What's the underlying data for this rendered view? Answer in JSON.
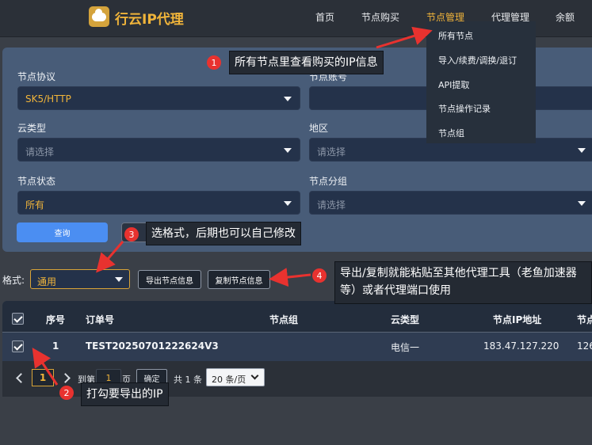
{
  "header": {
    "brand": "行云IP代理",
    "nav": [
      "首页",
      "节点购买",
      "节点管理",
      "代理管理",
      "余额"
    ]
  },
  "dropdown": [
    "所有节点",
    "导入/续费/调换/退订",
    "API提取",
    "节点操作记录",
    "节点组"
  ],
  "filters": {
    "protocol": {
      "label": "节点协议",
      "value": "SK5/HTTP"
    },
    "account": {
      "label": "节点账号",
      "value": ""
    },
    "cloud_type": {
      "label": "云类型",
      "placeholder": "请选择"
    },
    "region": {
      "label": "地区",
      "placeholder": "请选择"
    },
    "status": {
      "label": "节点状态",
      "value": "所有"
    },
    "group": {
      "label": "节点分组",
      "placeholder": "请选择"
    }
  },
  "query_button": "查询",
  "format": {
    "label": "格式:",
    "value": "通用"
  },
  "export_button": "导出节点信息",
  "copy_button": "复制节点信息",
  "table": {
    "columns": [
      "序号",
      "订单号",
      "节点组",
      "云类型",
      "节点IP地址",
      "节点"
    ],
    "rows": [
      {
        "index": "1",
        "order": "TEST20250701222624V3",
        "group": "",
        "cloud": "电信一",
        "ip": "183.47.127.220",
        "port": "126"
      }
    ]
  },
  "pagination": {
    "current": "1",
    "goto_label": "到第",
    "goto_value": "1",
    "page_label": "页",
    "confirm": "确定",
    "total": "共 1 条",
    "page_size": "20 条/页"
  },
  "annotations": [
    {
      "num": "1",
      "text": "所有节点里查看购买的IP信息"
    },
    {
      "num": "2",
      "text": "打勾要导出的IP"
    },
    {
      "num": "3",
      "text": "选格式，后期也可以自己修改"
    },
    {
      "num": "4",
      "text": "导出/复制就能粘贴至其他代理工具（老鱼加速器等）或者代理端口使用"
    }
  ],
  "colors": {
    "accent": "#f0b43a",
    "primary_button": "#4b8ef2",
    "annotation": "#e8322f"
  }
}
